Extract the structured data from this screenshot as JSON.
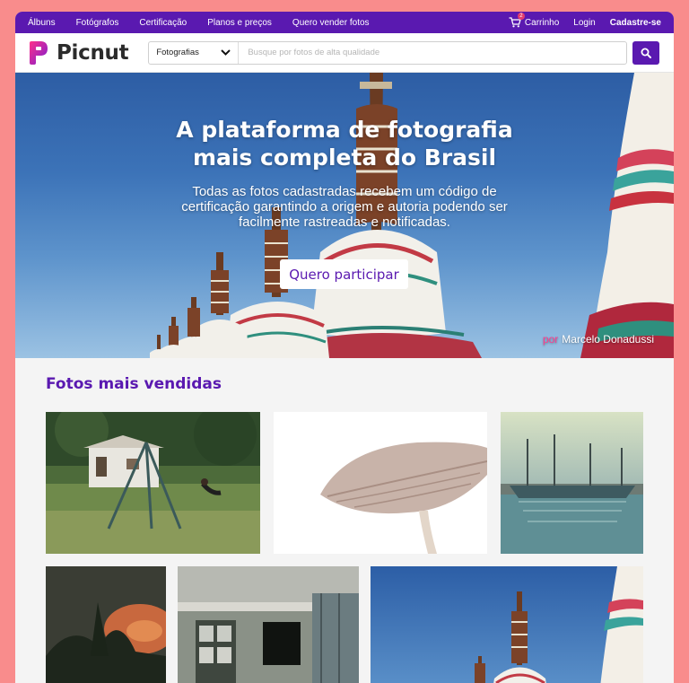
{
  "topnav": {
    "items": [
      "Álbuns",
      "Fotógrafos",
      "Certificação",
      "Planos e preços",
      "Quero vender fotos"
    ],
    "cart_label": "Carrinho",
    "cart_count": "2",
    "login_label": "Login",
    "signup_label": "Cadastre-se"
  },
  "header": {
    "logo_text": "Picnut",
    "search_category": "Fotografias",
    "search_placeholder": "Busque por fotos de alta qualidade"
  },
  "hero": {
    "title": "A plataforma de fotografia mais completa do Brasil",
    "subtitle": "Todas as fotos cadastradas recebem um código de certificação garantindo a origem e autoria podendo ser facilmente rastreadas e notificadas.",
    "cta_label": "Quero participar",
    "credit_prefix": "por",
    "credit_name": "Marcelo Donadussi"
  },
  "section": {
    "title": "Fotos mais vendidas"
  },
  "colors": {
    "brand": "#5a19b0",
    "accent_pink": "#e23b6d",
    "background_frame": "#f98c8c"
  }
}
